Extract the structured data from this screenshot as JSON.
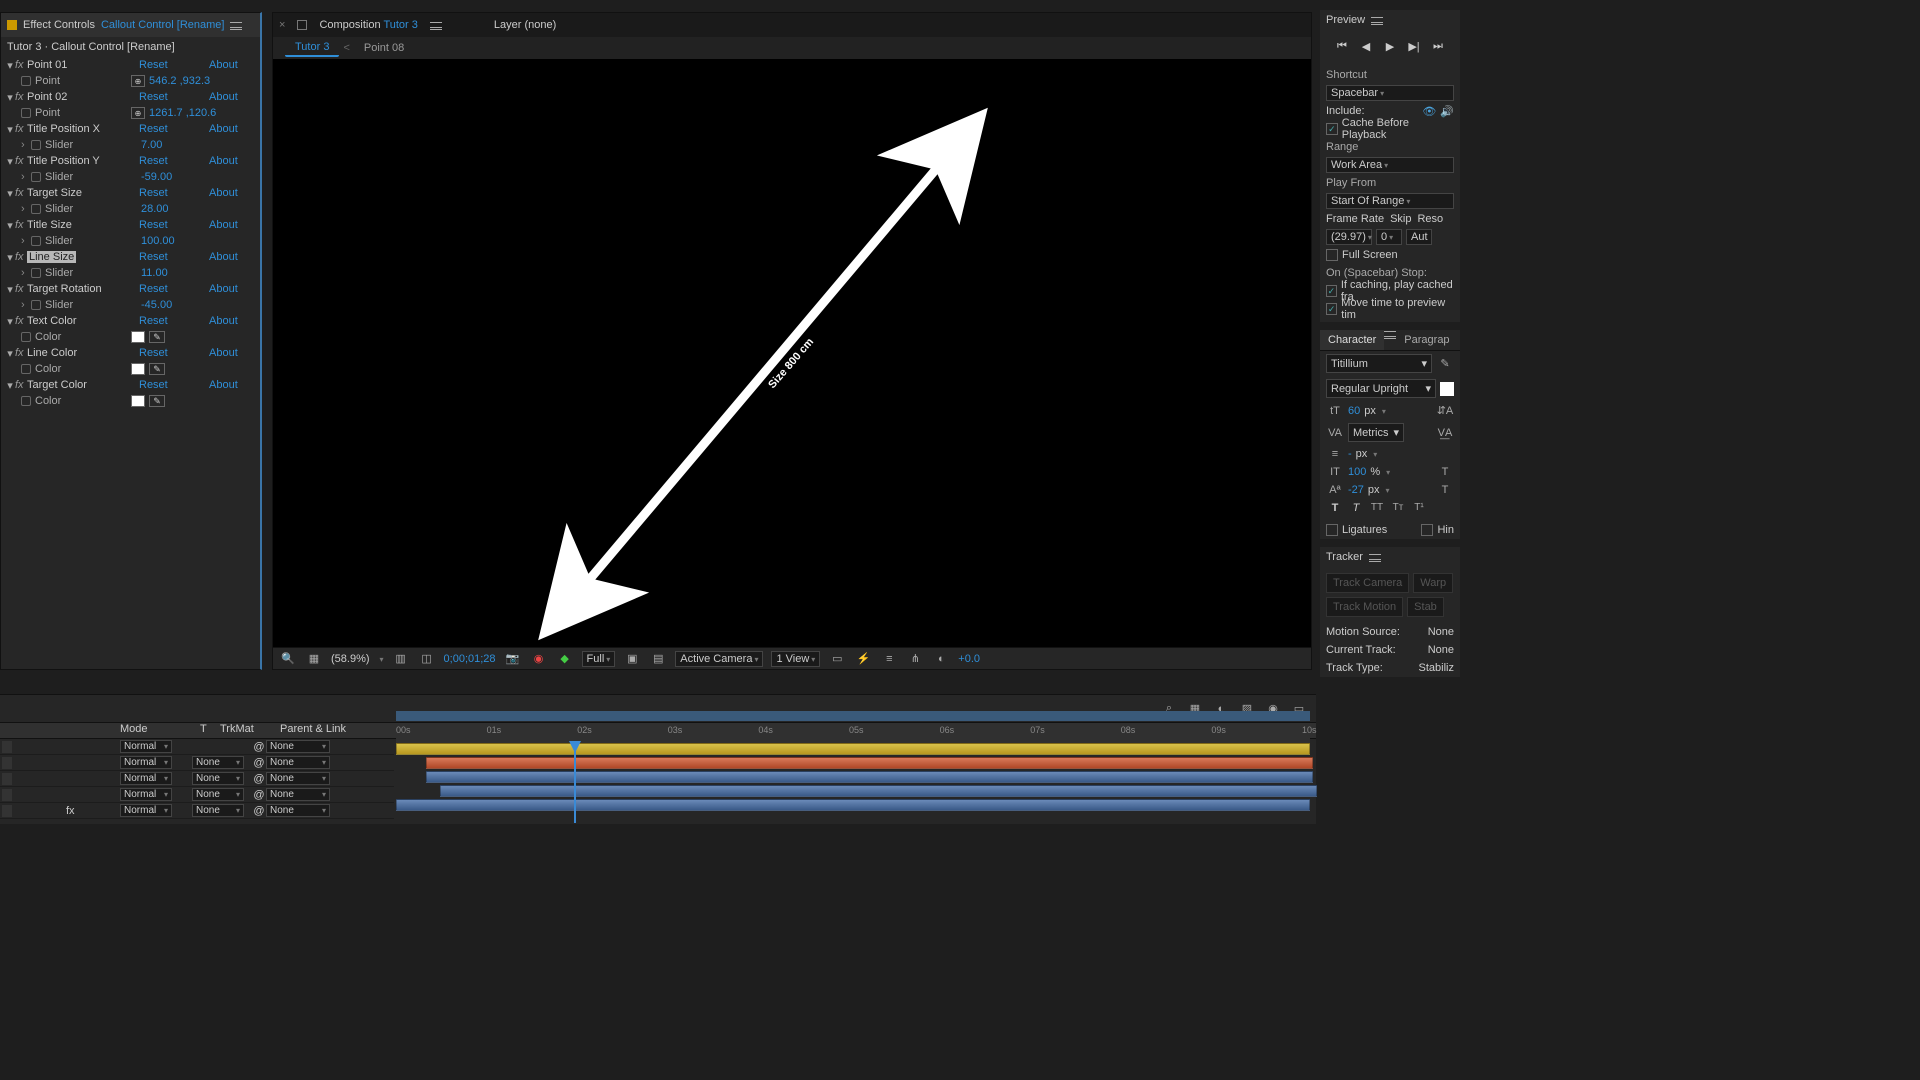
{
  "fx": {
    "panelTitle": "Effect Controls",
    "layerName": "Callout Control [Rename]",
    "layerPath": "Tutor 3 · Callout Control [Rename]",
    "reset": "Reset",
    "about": "About",
    "props": [
      {
        "name": "Point 01",
        "type": "point",
        "sub": "Point",
        "val": "546.2 ,932.3"
      },
      {
        "name": "Point 02",
        "type": "point",
        "sub": "Point",
        "val": "1261.7 ,120.6"
      },
      {
        "name": "Title Position X",
        "type": "slider",
        "sub": "Slider",
        "val": "7.00"
      },
      {
        "name": "Title Position Y",
        "type": "slider",
        "sub": "Slider",
        "val": "-59.00"
      },
      {
        "name": "Target Size",
        "type": "slider",
        "sub": "Slider",
        "val": "28.00"
      },
      {
        "name": "Title Size",
        "type": "slider",
        "sub": "Slider",
        "val": "100.00"
      },
      {
        "name": "Line Size",
        "type": "slider",
        "sub": "Slider",
        "val": "11.00",
        "selected": true
      },
      {
        "name": "Target Rotation",
        "type": "slider",
        "sub": "Slider",
        "val": "-45.00"
      },
      {
        "name": "Text Color",
        "type": "color",
        "sub": "Color"
      },
      {
        "name": "Line Color",
        "type": "color",
        "sub": "Color"
      },
      {
        "name": "Target Color",
        "type": "color",
        "sub": "Color"
      }
    ]
  },
  "comp": {
    "tabLabel": "Composition",
    "compName": "Tutor 3",
    "layerTab": "Layer",
    "layerNone": "(none)",
    "flow": [
      "Tutor 3",
      "Point 08"
    ],
    "overlayText": "Size 800 cm",
    "toolbar": {
      "zoom": "(58.9%)",
      "timecode": "0;00;01;28",
      "res": "Full",
      "camera": "Active Camera",
      "views": "1 View",
      "exposure": "+0.0"
    }
  },
  "preview": {
    "title": "Preview",
    "shortcut": "Shortcut",
    "shortcutVal": "Spacebar",
    "include": "Include:",
    "cache": "Cache Before Playback",
    "range": "Range",
    "rangeVal": "Work Area",
    "playFrom": "Play From",
    "playFromVal": "Start Of Range",
    "frameRate": "Frame Rate",
    "skip": "Skip",
    "reso": "Reso",
    "frVal": "(29.97)",
    "skipVal": "0",
    "resoVal": "Aut",
    "fullScreen": "Full Screen",
    "onStop": "On (Spacebar) Stop:",
    "ifCaching": "If caching, play cached fra",
    "moveTime": "Move time to preview tim"
  },
  "char": {
    "tab1": "Character",
    "tab2": "Paragrap",
    "font": "Titillium",
    "style": "Regular Upright",
    "size": "60",
    "sizeUnit": "px",
    "kern": "Metrics",
    "lead": "-",
    "leadUnit": "px",
    "vscale": "100",
    "vscaleUnit": "%",
    "baseline": "-27",
    "baselineUnit": "px",
    "lig": "Ligatures",
    "hin": "Hin"
  },
  "tracker": {
    "title": "Tracker",
    "btns": [
      "Track Camera",
      "Warp",
      "Track Motion",
      "Stab"
    ],
    "motionSource": "Motion Source:",
    "motionSourceVal": "None",
    "current": "Current Track:",
    "currentVal": "None",
    "trackType": "Track Type:",
    "trackTypeVal": "Stabiliz"
  },
  "timeline": {
    "cols": {
      "mode": "Mode",
      "trkmat": "TrkMat",
      "parent": "Parent & Link",
      "t": "T"
    },
    "modeVal": "Normal",
    "noneVal": "None",
    "ticks": [
      "00s",
      "01s",
      "02s",
      "03s",
      "04s",
      "05s",
      "06s",
      "07s",
      "08s",
      "09s",
      "10s"
    ]
  }
}
